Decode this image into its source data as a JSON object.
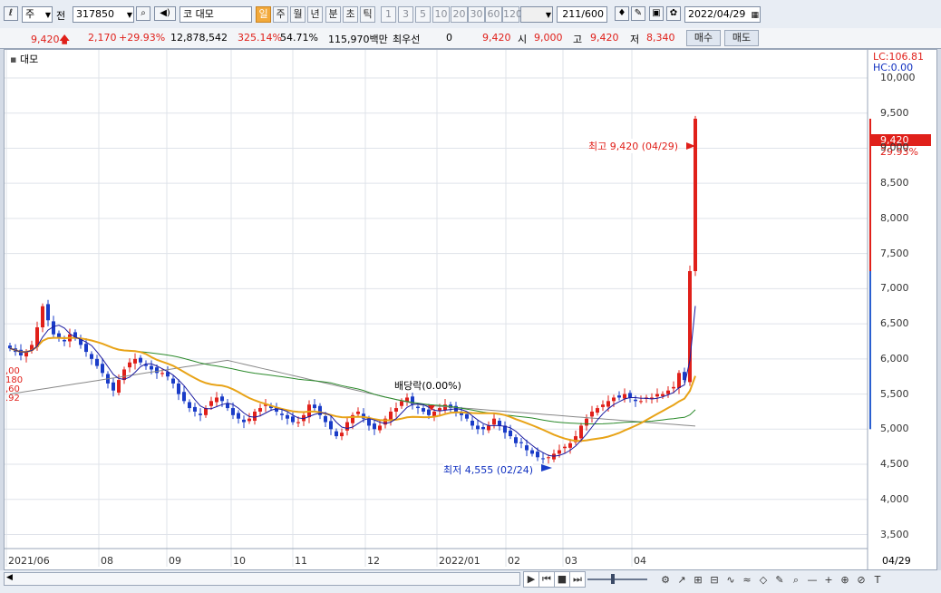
{
  "toolbar": {
    "market_select": "주",
    "prev_label": "전",
    "code": "317850",
    "stock_prefix": "코",
    "stock_name": "대모",
    "periods": [
      "일",
      "주",
      "월",
      "년",
      "분",
      "초",
      "틱"
    ],
    "intervals": [
      "1",
      "3",
      "5",
      "10",
      "20",
      "30",
      "60",
      "120"
    ],
    "count_value": "211",
    "count_total": "/600",
    "date": "2022/04/29"
  },
  "quote": {
    "price": "9,420",
    "change": "2,170",
    "change_pct": "+29.93%",
    "volume": "12,878,542",
    "vol_ratio": "325.14%",
    "turnover": "54.71%",
    "amount": "115,970백만",
    "pref_label": "최우선",
    "pref_value": "0",
    "price2": "9,420",
    "open_label": "시",
    "open": "9,000",
    "high_label": "고",
    "high": "9,420",
    "low_label": "저",
    "low": "8,340",
    "buy_label": "매수",
    "sell_label": "매도"
  },
  "chart": {
    "legend_name": "대모",
    "lc": "LC:106.81",
    "hc": "HC:0.00",
    "current_price": "9,420",
    "current_pct": "29.93%",
    "high_annotation": "최고 9,420 (04/29)",
    "low_annotation": "최저 4,555 (02/24)",
    "dividend_annotation": "배당락(0.00%)",
    "left_edge_labels": [
      ",00",
      "180",
      ",60",
      ".92"
    ],
    "y_ticks": [
      "10,000",
      "9,500",
      "9,000",
      "8,500",
      "8,000",
      "7,500",
      "7,000",
      "6,500",
      "6,000",
      "5,500",
      "5,000",
      "4,500",
      "4,000",
      "3,500"
    ],
    "x_ticks": [
      "2021/06",
      "08",
      "09",
      "10",
      "11",
      "12",
      "2022/01",
      "02",
      "03",
      "04"
    ],
    "x_right_label": "04/29",
    "colors": {
      "up": "#e0201a",
      "down": "#1a3cc8",
      "ma5": "#1a1aa0",
      "ma20": "#e8a317",
      "ma60": "#2b8a2b",
      "ma120": "#888888"
    }
  },
  "chart_data": {
    "type": "candlestick",
    "ylim": [
      3300,
      10400
    ],
    "close_series": [
      6150,
      6100,
      6050,
      6100,
      6200,
      6450,
      6750,
      6550,
      6350,
      6300,
      6250,
      6350,
      6300,
      6200,
      6100,
      6000,
      5900,
      5800,
      5650,
      5550,
      5700,
      5850,
      5950,
      6000,
      5950,
      5900,
      5850,
      5800,
      5800,
      5750,
      5650,
      5500,
      5400,
      5300,
      5250,
      5200,
      5300,
      5400,
      5450,
      5400,
      5300,
      5200,
      5150,
      5100,
      5150,
      5250,
      5300,
      5350,
      5300,
      5250,
      5200,
      5150,
      5100,
      5100,
      5200,
      5350,
      5300,
      5200,
      5100,
      5000,
      4900,
      4950,
      5100,
      5200,
      5250,
      5150,
      5050,
      5000,
      5050,
      5150,
      5250,
      5300,
      5400,
      5450,
      5350,
      5300,
      5250,
      5200,
      5250,
      5300,
      5350,
      5300,
      5250,
      5200,
      5150,
      5050,
      5000,
      5000,
      5050,
      5150,
      5050,
      4950,
      4900,
      4800,
      4800,
      4700,
      4650,
      4600,
      4580,
      4600,
      4650,
      4700,
      4750,
      4800,
      4900,
      5050,
      5150,
      5250,
      5300,
      5350,
      5400,
      5450,
      5450,
      5500,
      5450,
      5400,
      5400,
      5450,
      5450,
      5500,
      5500,
      5550,
      5600,
      5800,
      5700,
      7250,
      9420
    ]
  },
  "footer": {
    "nav_buttons": [
      "▶",
      "⏮",
      "■",
      "⏭"
    ],
    "tools": [
      "⚙",
      "↗",
      "⊞",
      "⊟",
      "∿",
      "≈",
      "◇",
      "✎",
      "⌕",
      "—",
      "+",
      "⊕",
      "⊘",
      "T"
    ]
  }
}
